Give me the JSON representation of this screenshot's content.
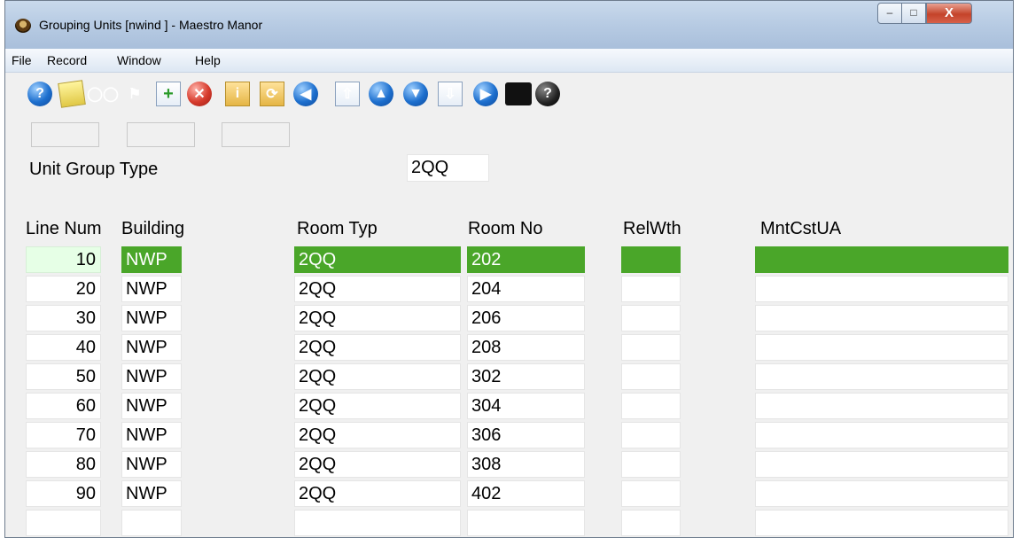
{
  "window": {
    "title": "Grouping Units [nwind   ] - Maestro Manor",
    "controls": {
      "minimize": "–",
      "maximize": "□",
      "close": "X"
    }
  },
  "menu": [
    "File",
    "Record",
    "Window",
    "Help"
  ],
  "toolbar": [
    "help-icon",
    "note-icon",
    "binoculars-icon",
    "exit-door-icon",
    "new-record-icon",
    "delete-record-icon",
    "info-folder-icon",
    "refresh-folder-icon",
    "first-record-icon",
    "page-up-icon",
    "previous-record-icon",
    "next-record-icon",
    "page-down-icon",
    "last-record-icon",
    "console-icon",
    "context-help-icon"
  ],
  "form": {
    "unit_group_type_label": "Unit Group Type",
    "unit_group_type_value": "2QQ"
  },
  "grid": {
    "columns": [
      "Line Num",
      "Building",
      "Room Typ",
      "Room No",
      "RelWth",
      "MntCstUA"
    ],
    "rows": [
      {
        "line": "10",
        "building": "NWP",
        "room_typ": "2QQ",
        "room_no": "202",
        "relwth": "",
        "mntcst": ""
      },
      {
        "line": "20",
        "building": "NWP",
        "room_typ": "2QQ",
        "room_no": "204",
        "relwth": "",
        "mntcst": ""
      },
      {
        "line": "30",
        "building": "NWP",
        "room_typ": "2QQ",
        "room_no": "206",
        "relwth": "",
        "mntcst": ""
      },
      {
        "line": "40",
        "building": "NWP",
        "room_typ": "2QQ",
        "room_no": "208",
        "relwth": "",
        "mntcst": ""
      },
      {
        "line": "50",
        "building": "NWP",
        "room_typ": "2QQ",
        "room_no": "302",
        "relwth": "",
        "mntcst": ""
      },
      {
        "line": "60",
        "building": "NWP",
        "room_typ": "2QQ",
        "room_no": "304",
        "relwth": "",
        "mntcst": ""
      },
      {
        "line": "70",
        "building": "NWP",
        "room_typ": "2QQ",
        "room_no": "306",
        "relwth": "",
        "mntcst": ""
      },
      {
        "line": "80",
        "building": "NWP",
        "room_typ": "2QQ",
        "room_no": "308",
        "relwth": "",
        "mntcst": ""
      },
      {
        "line": "90",
        "building": "NWP",
        "room_typ": "2QQ",
        "room_no": "402",
        "relwth": "",
        "mntcst": ""
      },
      {
        "line": "",
        "building": "",
        "room_typ": "",
        "room_no": "",
        "relwth": "",
        "mntcst": ""
      }
    ],
    "selected_row": 0
  },
  "colors": {
    "selection": "#4aa629",
    "current_cell": "#e6ffe6"
  }
}
